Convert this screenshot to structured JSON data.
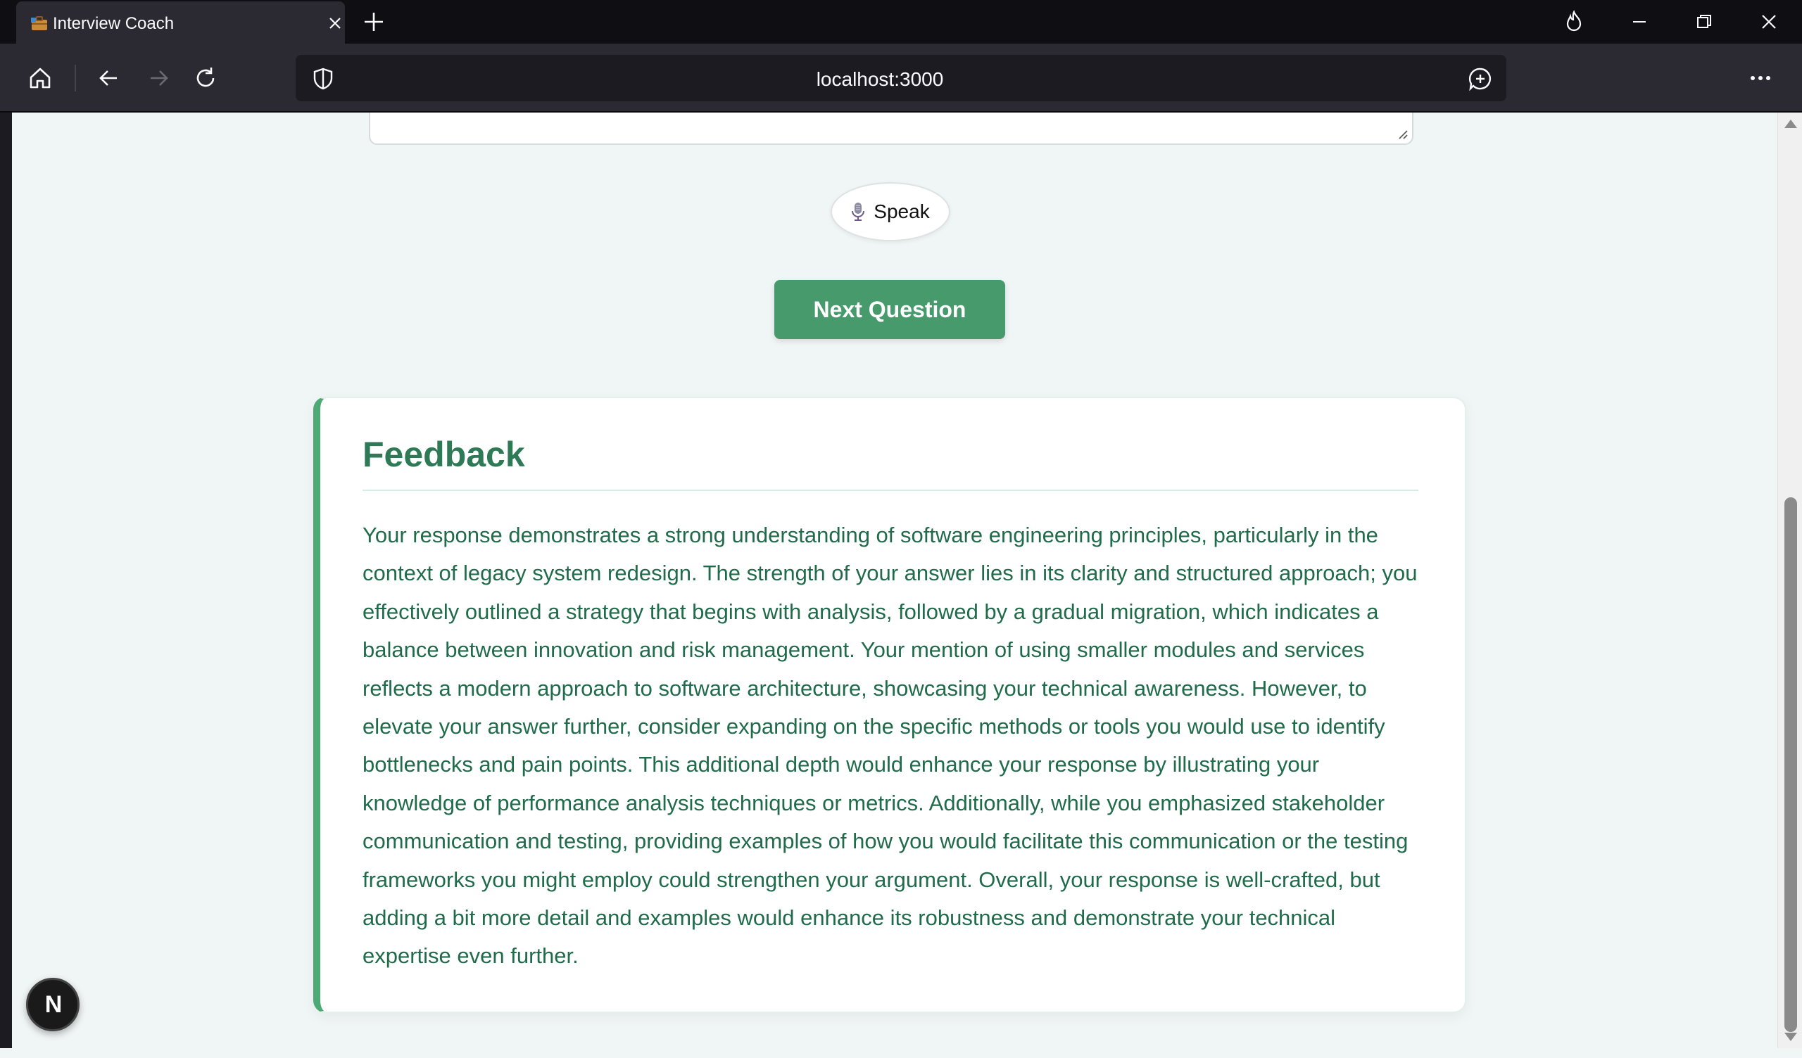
{
  "browser": {
    "tab_title": "Interview Coach",
    "url": "localhost:3000"
  },
  "page": {
    "speak_label": "Speak",
    "next_question_label": "Next Question",
    "feedback": {
      "title": "Feedback",
      "body": "Your response demonstrates a strong understanding of software engineering principles, particularly in the context of legacy system redesign. The strength of your answer lies in its clarity and structured approach; you effectively outlined a strategy that begins with analysis, followed by a gradual migration, which indicates a balance between innovation and risk management. Your mention of using smaller modules and services reflects a modern approach to software architecture, showcasing your technical awareness. However, to elevate your answer further, consider expanding on the specific methods or tools you would use to identify bottlenecks and pain points. This additional depth would enhance your response by illustrating your knowledge of performance analysis techniques or metrics. Additionally, while you emphasized stakeholder communication and testing, providing examples of how you would facilitate this communication or the testing frameworks you might employ could strengthen your argument. Overall, your response is well-crafted, but adding a bit more detail and examples would enhance its robustness and demonstrate your technical expertise even further."
    },
    "dev_badge_letter": "N"
  },
  "colors": {
    "accent_green": "#469a6c",
    "feedback_title": "#2e7a57",
    "feedback_text": "#1f6b4a",
    "page_bg": "#f0f5f5"
  },
  "icons": {
    "home": "home-icon",
    "back": "arrow-left-icon",
    "forward": "arrow-right-icon",
    "reload": "reload-icon",
    "shield": "shield-icon",
    "extension": "chat-plus-icon",
    "menu": "more-horizontal-icon",
    "mic": "microphone-icon"
  }
}
